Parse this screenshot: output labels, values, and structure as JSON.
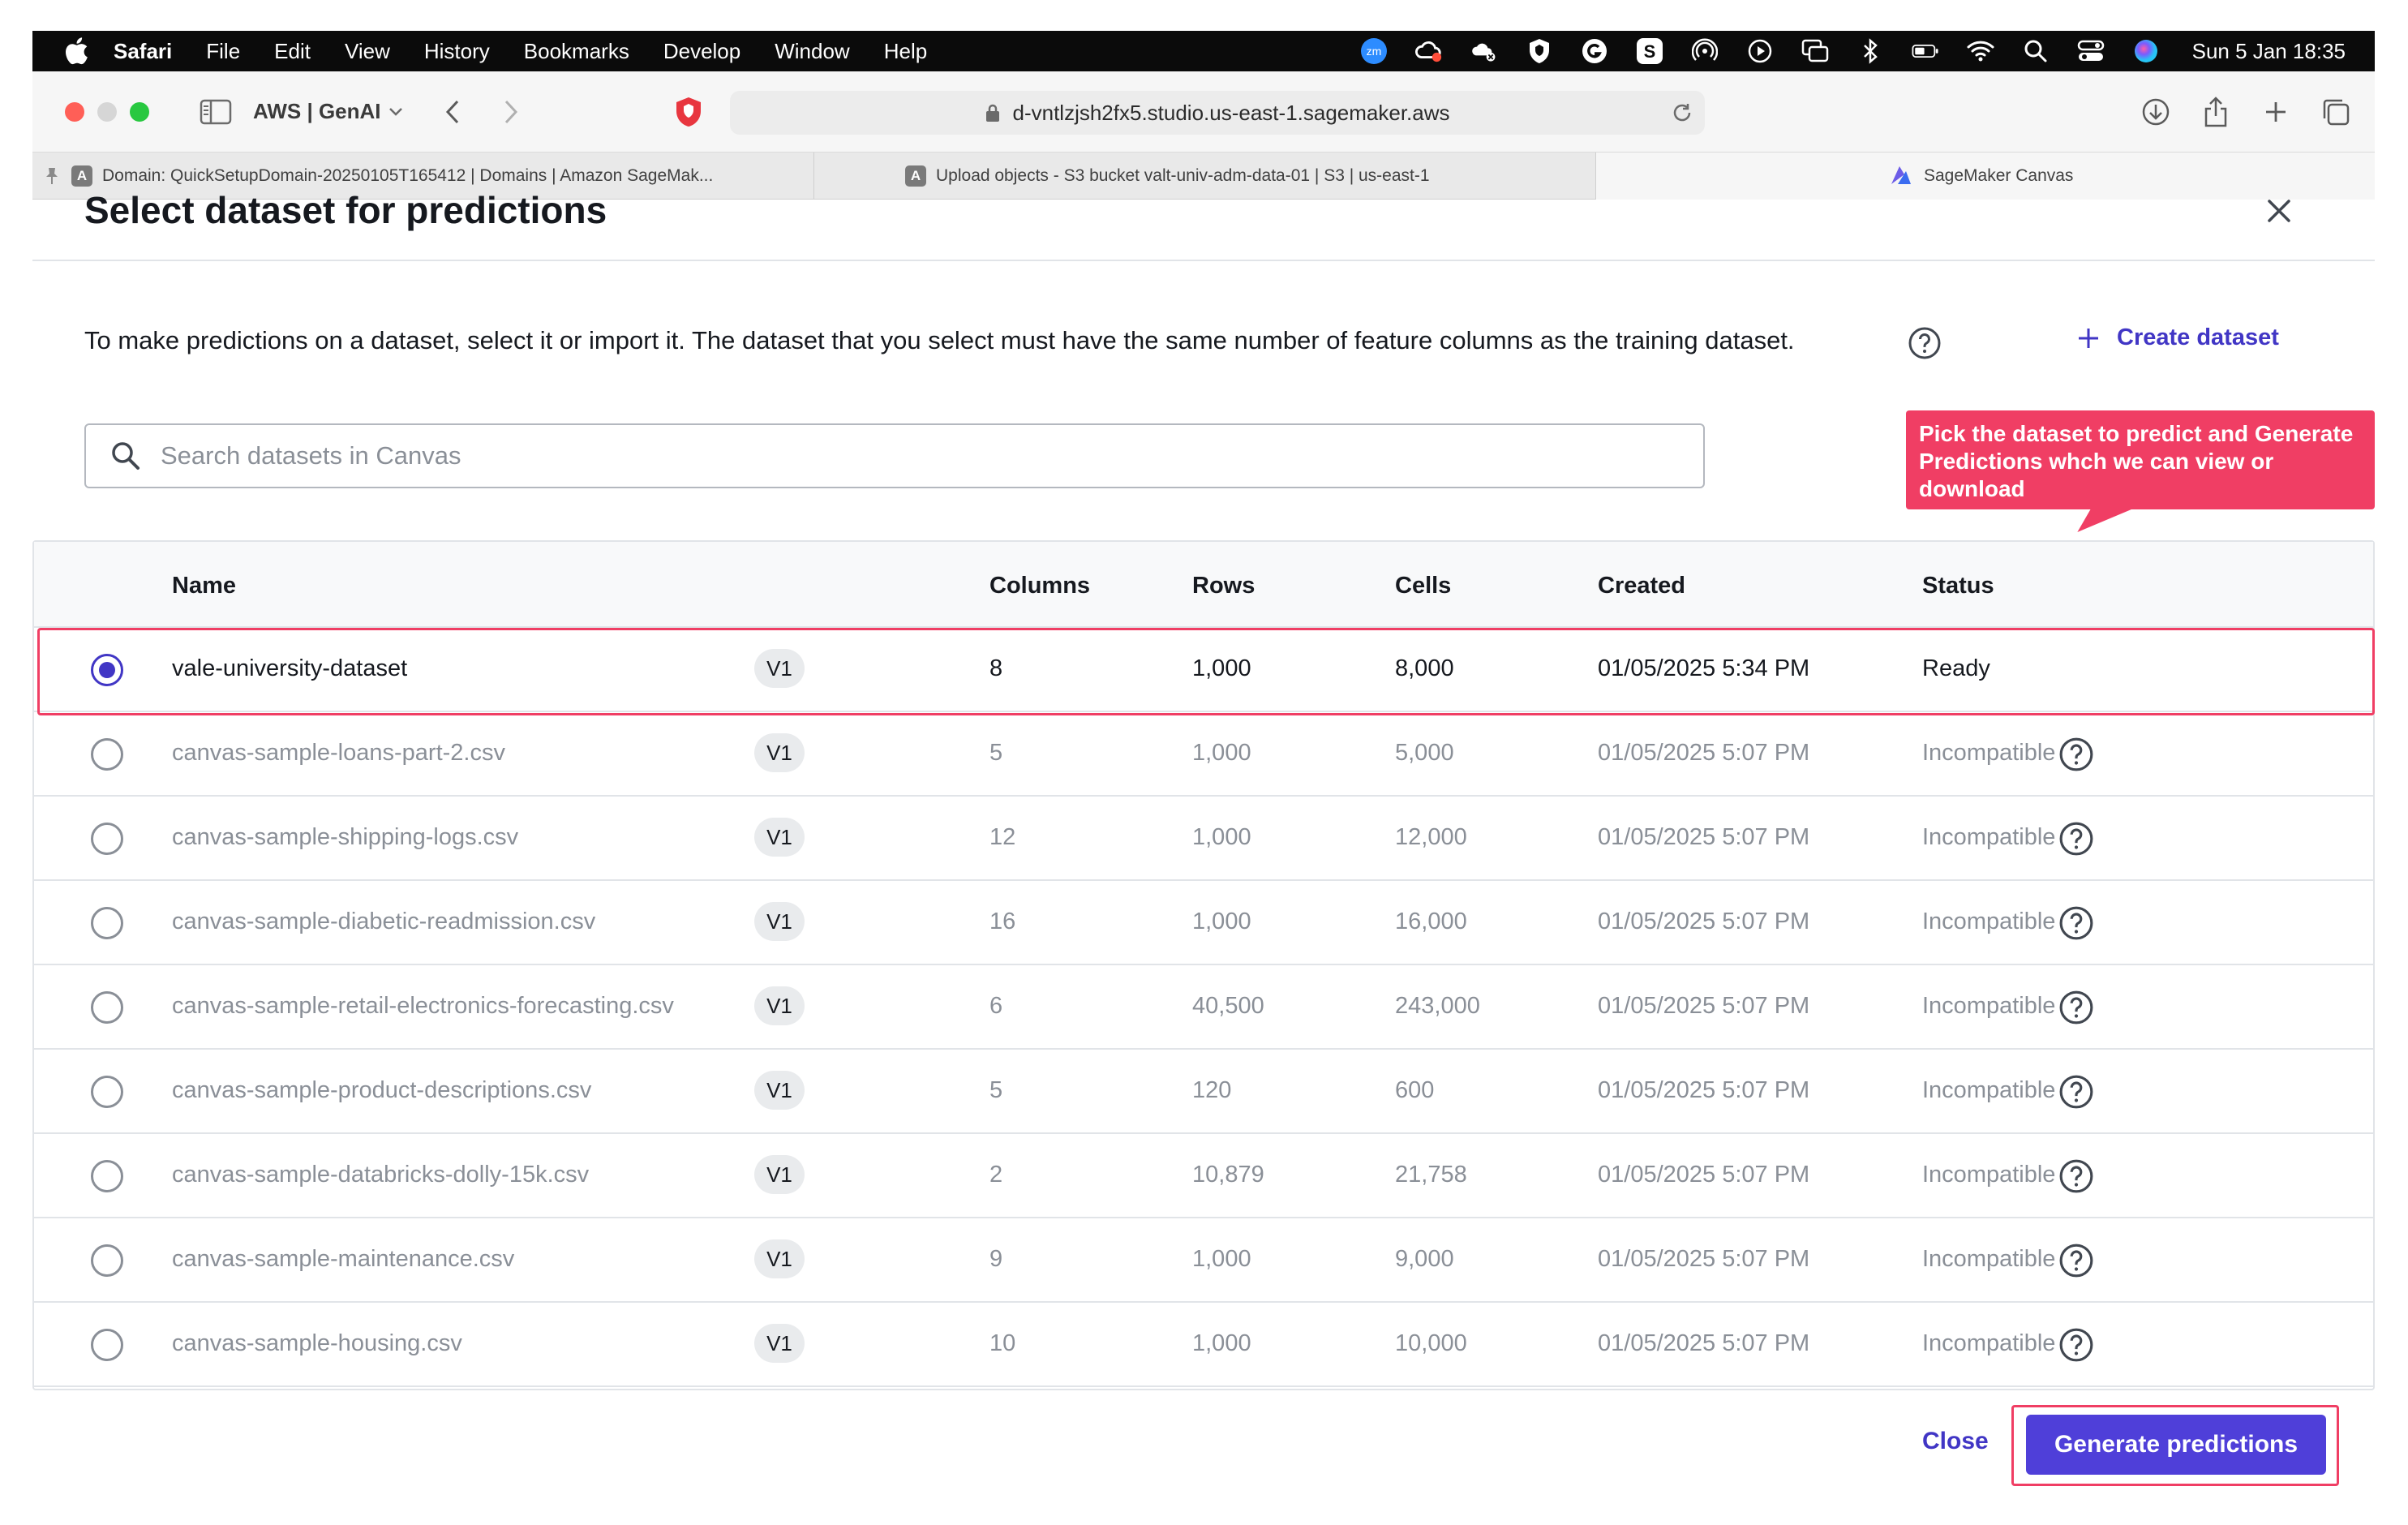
{
  "menubar": {
    "app": "Safari",
    "items": [
      "File",
      "Edit",
      "View",
      "History",
      "Bookmarks",
      "Develop",
      "Window",
      "Help"
    ],
    "clock": "Sun 5 Jan  18:35",
    "zoom_badge": "zm",
    "status_icons": [
      "zoom-icon",
      "creative-cloud-icon",
      "cloud-sync-icon",
      "shield-icon",
      "grammarly-icon",
      "s-app-icon",
      "airdrop-icon",
      "play-icon",
      "screen-mirror-icon",
      "bluetooth-icon",
      "battery-icon",
      "wifi-icon",
      "spotlight-icon",
      "control-center-icon",
      "siri-icon"
    ]
  },
  "toolbar": {
    "profile": "AWS | GenAI",
    "url": "d-vntlzjsh2fx5.studio.us-east-1.sagemaker.aws"
  },
  "tabs": [
    {
      "label": "Domain: QuickSetupDomain-20250105T165412 | Domains | Amazon SageMak...",
      "favicon": "A",
      "pinned": true
    },
    {
      "label": "Upload objects - S3 bucket valt-univ-adm-data-01 | S3 | us-east-1",
      "favicon": "A",
      "pinned": false
    },
    {
      "label": "SageMaker Canvas",
      "favicon": "canvas-icon",
      "pinned": false
    }
  ],
  "modal": {
    "title": "Select dataset for predictions",
    "intro": "To make predictions on a dataset, select it or import it. The dataset that you select must have the same number of feature columns as the training dataset.",
    "create_label": "Create dataset",
    "search_placeholder": "Search datasets in Canvas",
    "close_label": "Close",
    "generate_label": "Generate predictions"
  },
  "callout": {
    "text": "Pick the dataset to predict and Generate Predictions whch we can view or download"
  },
  "table": {
    "headers": {
      "name": "Name",
      "columns": "Columns",
      "rows": "Rows",
      "cells": "Cells",
      "created": "Created",
      "status": "Status"
    },
    "rows": [
      {
        "name": "vale-university-dataset",
        "version": "V1",
        "columns": "8",
        "rows": "1,000",
        "cells": "8,000",
        "created": "01/05/2025 5:34 PM",
        "status": "Ready",
        "selected": true
      },
      {
        "name": "canvas-sample-loans-part-2.csv",
        "version": "V1",
        "columns": "5",
        "rows": "1,000",
        "cells": "5,000",
        "created": "01/05/2025 5:07 PM",
        "status": "Incompatible",
        "selected": false
      },
      {
        "name": "canvas-sample-shipping-logs.csv",
        "version": "V1",
        "columns": "12",
        "rows": "1,000",
        "cells": "12,000",
        "created": "01/05/2025 5:07 PM",
        "status": "Incompatible",
        "selected": false
      },
      {
        "name": "canvas-sample-diabetic-readmission.csv",
        "version": "V1",
        "columns": "16",
        "rows": "1,000",
        "cells": "16,000",
        "created": "01/05/2025 5:07 PM",
        "status": "Incompatible",
        "selected": false
      },
      {
        "name": "canvas-sample-retail-electronics-forecasting.csv",
        "version": "V1",
        "columns": "6",
        "rows": "40,500",
        "cells": "243,000",
        "created": "01/05/2025 5:07 PM",
        "status": "Incompatible",
        "selected": false
      },
      {
        "name": "canvas-sample-product-descriptions.csv",
        "version": "V1",
        "columns": "5",
        "rows": "120",
        "cells": "600",
        "created": "01/05/2025 5:07 PM",
        "status": "Incompatible",
        "selected": false
      },
      {
        "name": "canvas-sample-databricks-dolly-15k.csv",
        "version": "V1",
        "columns": "2",
        "rows": "10,879",
        "cells": "21,758",
        "created": "01/05/2025 5:07 PM",
        "status": "Incompatible",
        "selected": false
      },
      {
        "name": "canvas-sample-maintenance.csv",
        "version": "V1",
        "columns": "9",
        "rows": "1,000",
        "cells": "9,000",
        "created": "01/05/2025 5:07 PM",
        "status": "Incompatible",
        "selected": false
      },
      {
        "name": "canvas-sample-housing.csv",
        "version": "V1",
        "columns": "10",
        "rows": "1,000",
        "cells": "10,000",
        "created": "01/05/2025 5:07 PM",
        "status": "Incompatible",
        "selected": false
      }
    ]
  },
  "colors": {
    "accent": "#4136c5",
    "primary_button": "#4f3fd9",
    "annotation": "#f03e64",
    "muted_text": "#8a8f97"
  }
}
